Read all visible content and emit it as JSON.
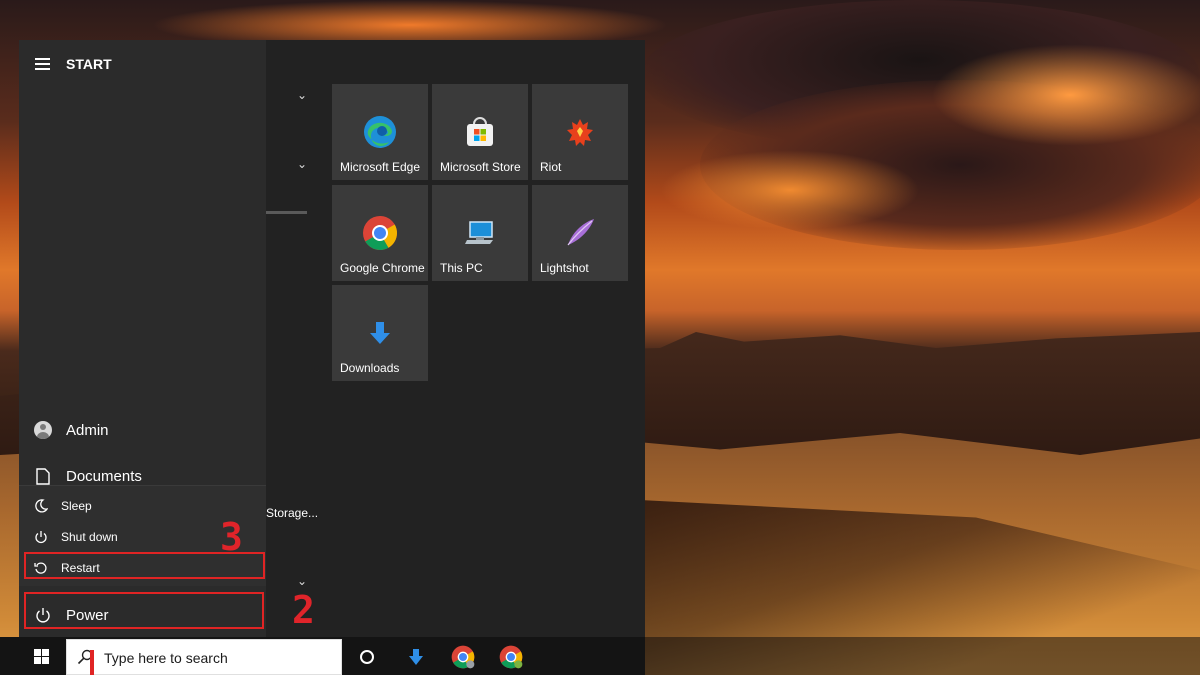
{
  "start_menu": {
    "title": "START",
    "user": "Admin",
    "documents": "Documents",
    "power_options": {
      "sleep": "Sleep",
      "shutdown": "Shut down",
      "restart": "Restart"
    },
    "power": "Power",
    "app_list_partial": "Storage...",
    "tiles": [
      {
        "label": "Microsoft Edge",
        "icon": "edge-icon"
      },
      {
        "label": "Microsoft Store",
        "icon": "store-icon"
      },
      {
        "label": "Riot",
        "icon": "riot-icon"
      },
      {
        "label": "Google Chrome",
        "icon": "chrome-icon"
      },
      {
        "label": "This PC",
        "icon": "this-pc-icon"
      },
      {
        "label": "Lightshot",
        "icon": "lightshot-icon"
      },
      {
        "label": "Downloads",
        "icon": "downloads-icon"
      }
    ]
  },
  "annotations": {
    "step1": "1",
    "step2": "2",
    "step3": "3",
    "highlight_color": "#e02424"
  },
  "taskbar": {
    "search_placeholder": "Type here to search",
    "icons": [
      "cortana-icon",
      "downloads-arrow-icon",
      "chrome-icon",
      "chrome-profile-icon"
    ]
  },
  "colors": {
    "menu_bg": "#222222",
    "rail_bg": "#2b2b2b",
    "tile_bg": "#3a3a3a",
    "edge_blue": "#1e90d8",
    "chrome_red": "#db4437"
  }
}
